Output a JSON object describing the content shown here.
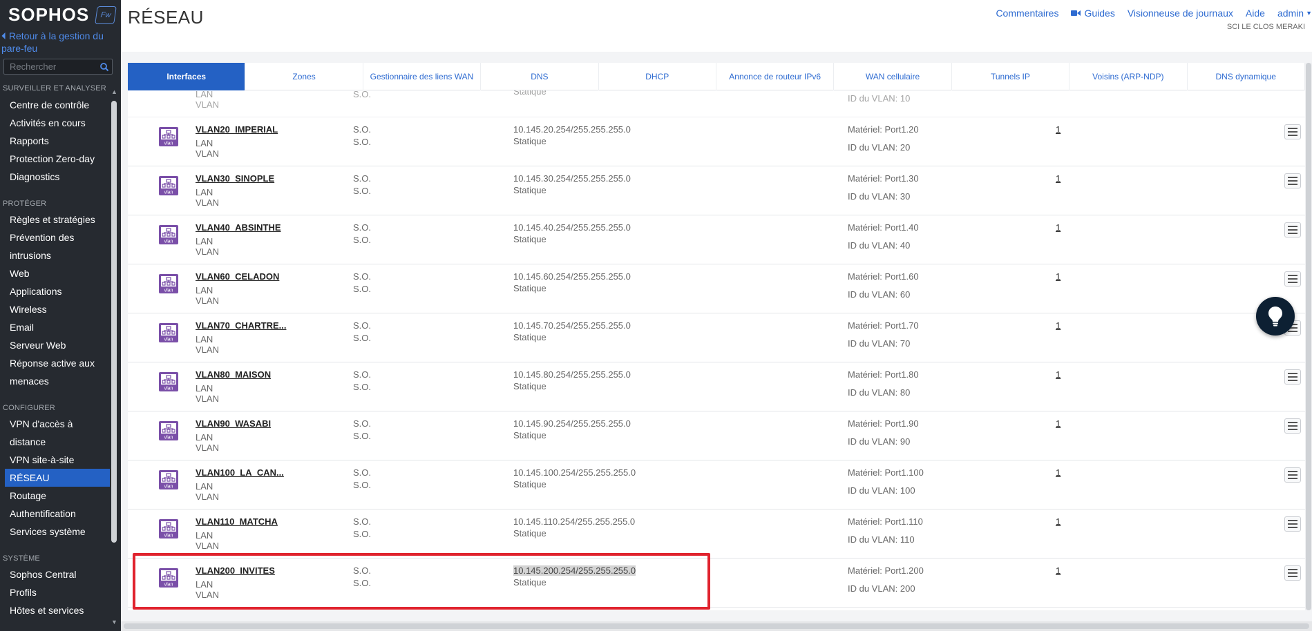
{
  "sidebar": {
    "logo": "SOPHOS",
    "badge": "Fw",
    "back_link": "Retour à la gestion du pare-feu",
    "search_placeholder": "Rechercher",
    "sections": {
      "monitor": "SURVEILLER ET ANALYSER",
      "protect": "PROTÉGER",
      "configure": "CONFIGURER",
      "system": "SYSTÈME"
    },
    "monitor_items": [
      "Centre de contrôle",
      "Activités en cours",
      "Rapports",
      "Protection Zero-day",
      "Diagnostics"
    ],
    "protect_items": [
      "Règles et stratégies",
      "Prévention des",
      "intrusions",
      "Web",
      "Applications",
      "Wireless",
      "Email",
      "Serveur Web",
      "Réponse active aux",
      "menaces"
    ],
    "configure_items": [
      "VPN d'accès à",
      "distance",
      "VPN site-à-site",
      "RÉSEAU",
      "Routage",
      "Authentification",
      "Services système"
    ],
    "system_items": [
      "Sophos Central",
      "Profils",
      "Hôtes et services"
    ],
    "active_item": "RÉSEAU"
  },
  "header": {
    "title": "RÉSEAU",
    "links": [
      "Commentaires",
      "Guides",
      "Visionneuse de journaux",
      "Aide",
      "admin"
    ],
    "tenant": "SCI LE CLOS MERAKI"
  },
  "tabs": [
    "Interfaces",
    "Zones",
    "Gestionnaire des liens WAN",
    "DNS",
    "DHCP",
    "Annonce de routeur IPv6",
    "WAN cellulaire",
    "Tunnels IP",
    "Voisins (ARP-NDP)",
    "DNS dynamique"
  ],
  "active_tab": "Interfaces",
  "partial_row": {
    "sub1": "LAN",
    "sub2": "VLAN",
    "so": "S.O.",
    "mode": "Statique",
    "vid": "ID du VLAN: 10"
  },
  "rows": [
    {
      "name": "VLAN20_IMPERIAL",
      "zone": "LAN",
      "type": "VLAN",
      "so1": "S.O.",
      "so2": "S.O.",
      "ip": "10.145.20.254/255.255.255.0",
      "mode": "Statique",
      "hw": "Matériel:  Port1.20",
      "vid": "ID du VLAN: 20",
      "count": "1"
    },
    {
      "name": "VLAN30_SINOPLE",
      "zone": "LAN",
      "type": "VLAN",
      "so1": "S.O.",
      "so2": "S.O.",
      "ip": "10.145.30.254/255.255.255.0",
      "mode": "Statique",
      "hw": "Matériel:  Port1.30",
      "vid": "ID du VLAN: 30",
      "count": "1"
    },
    {
      "name": "VLAN40_ABSINTHE",
      "zone": "LAN",
      "type": "VLAN",
      "so1": "S.O.",
      "so2": "S.O.",
      "ip": "10.145.40.254/255.255.255.0",
      "mode": "Statique",
      "hw": "Matériel:  Port1.40",
      "vid": "ID du VLAN: 40",
      "count": "1"
    },
    {
      "name": "VLAN60_CELADON",
      "zone": "LAN",
      "type": "VLAN",
      "so1": "S.O.",
      "so2": "S.O.",
      "ip": "10.145.60.254/255.255.255.0",
      "mode": "Statique",
      "hw": "Matériel:  Port1.60",
      "vid": "ID du VLAN: 60",
      "count": "1"
    },
    {
      "name": "VLAN70_CHARTRE...",
      "zone": "LAN",
      "type": "VLAN",
      "so1": "S.O.",
      "so2": "S.O.",
      "ip": "10.145.70.254/255.255.255.0",
      "mode": "Statique",
      "hw": "Matériel:  Port1.70",
      "vid": "ID du VLAN: 70",
      "count": "1"
    },
    {
      "name": "VLAN80_MAISON",
      "zone": "LAN",
      "type": "VLAN",
      "so1": "S.O.",
      "so2": "S.O.",
      "ip": "10.145.80.254/255.255.255.0",
      "mode": "Statique",
      "hw": "Matériel:  Port1.80",
      "vid": "ID du VLAN: 80",
      "count": "1"
    },
    {
      "name": "VLAN90_WASABI",
      "zone": "LAN",
      "type": "VLAN",
      "so1": "S.O.",
      "so2": "S.O.",
      "ip": "10.145.90.254/255.255.255.0",
      "mode": "Statique",
      "hw": "Matériel:  Port1.90",
      "vid": "ID du VLAN: 90",
      "count": "1"
    },
    {
      "name": "VLAN100_LA_CAN...",
      "zone": "LAN",
      "type": "VLAN",
      "so1": "S.O.",
      "so2": "S.O.",
      "ip": "10.145.100.254/255.255.255.0",
      "mode": "Statique",
      "hw": "Matériel:  Port1.100",
      "vid": "ID du VLAN: 100",
      "count": "1"
    },
    {
      "name": "VLAN110_MATCHA",
      "zone": "LAN",
      "type": "VLAN",
      "so1": "S.O.",
      "so2": "S.O.",
      "ip": "10.145.110.254/255.255.255.0",
      "mode": "Statique",
      "hw": "Matériel:  Port1.110",
      "vid": "ID du VLAN: 110",
      "count": "1"
    },
    {
      "name": "VLAN200_INVITES",
      "zone": "LAN",
      "type": "VLAN",
      "so1": "S.O.",
      "so2": "S.O.",
      "ip": "10.145.200.254/255.255.255.0",
      "mode": "Statique",
      "hw": "Matériel:  Port1.200",
      "vid": "ID du VLAN: 200",
      "count": "1",
      "ip_selected": true
    }
  ],
  "icon_label": "vlan",
  "colors": {
    "sidebar_bg": "#262a30",
    "accent": "#2461c4",
    "link": "#2e6bd1",
    "highlight_border": "#e0232e",
    "vlan_icon": "#7a4fa8"
  }
}
